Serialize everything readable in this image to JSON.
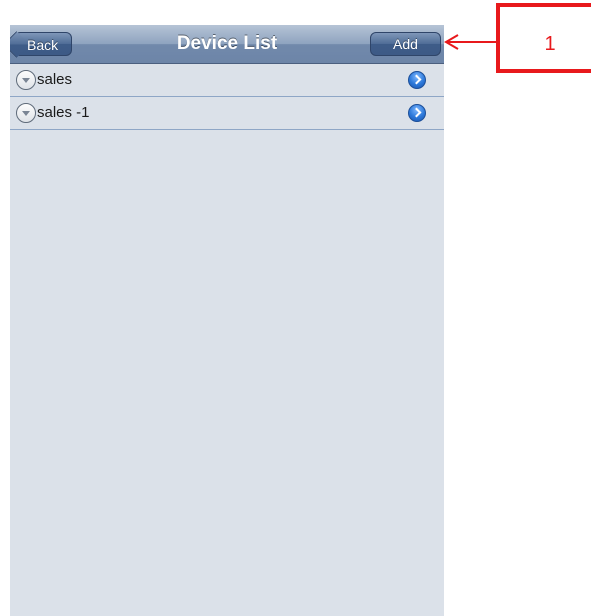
{
  "navbar": {
    "back_label": "Back",
    "title": "Device List",
    "add_label": "Add"
  },
  "devices": [
    {
      "name": "sales"
    },
    {
      "name": "sales -1"
    }
  ],
  "callout": {
    "number": "1",
    "color": "#e8191c"
  },
  "colors": {
    "navbar": "#7a90b2",
    "background": "#dbe1e9",
    "detail_accent": "#2c78d9"
  }
}
